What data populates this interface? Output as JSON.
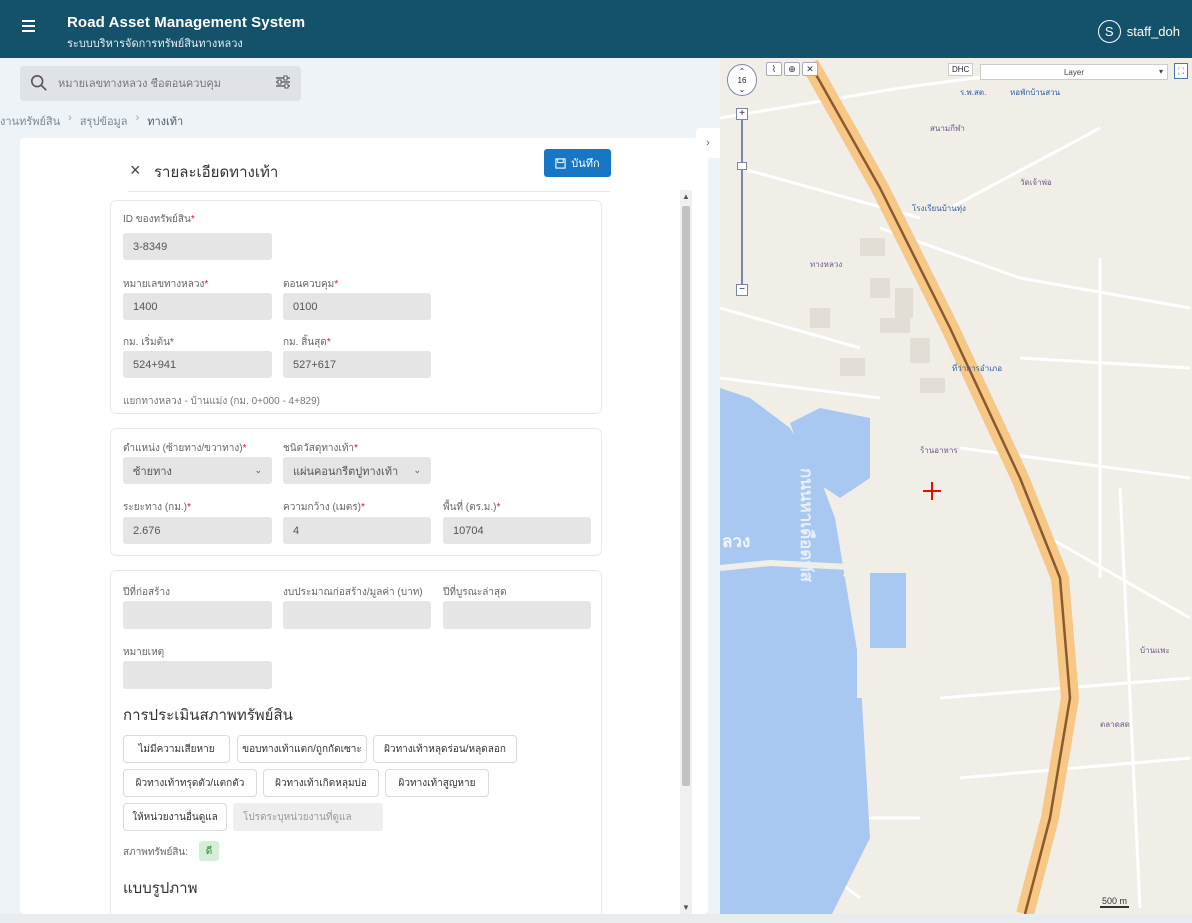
{
  "header": {
    "title": "Road Asset Management System",
    "subtitle": "ระบบบริหารจัดการทรัพย์สินทางหลวง",
    "user_initial": "S",
    "username": "staff_doh"
  },
  "search": {
    "placeholder": "หมายเลขทางหลวง ชื่อตอนควบคุม"
  },
  "breadcrumb": [
    "งานทรัพย์สิน",
    "สรุปข้อมูล",
    "ทางเท้า"
  ],
  "panel": {
    "title": "รายละเอียดทางเท้า",
    "save_label": "บันทึก"
  },
  "fields": {
    "asset_id": {
      "label": "ID ของทรัพย์สิน",
      "value": "3-8349"
    },
    "highway_no": {
      "label": "หมายเลขทางหลวง",
      "value": "1400"
    },
    "control_section": {
      "label": "ตอนควบคุม",
      "value": "0100"
    },
    "km_start": {
      "label": "กม. เริ่มต้น",
      "value": "524+941"
    },
    "km_end": {
      "label": "กม. สิ้นสุด",
      "value": "527+617"
    },
    "section_note": "แยกทางหลวง - บ้านแม่ง (กม. 0+000 - 4+829)",
    "position": {
      "label": "ตำแหน่ง (ซ้ายทาง/ขวาทาง)",
      "value": "ซ้ายทาง"
    },
    "material": {
      "label": "ชนิดวัสดุทางเท้า",
      "value": "แผ่นคอนกรีตปูทางเท้า"
    },
    "distance": {
      "label": "ระยะทาง (กม.)",
      "value": "2.676"
    },
    "width": {
      "label": "ความกว้าง (เมตร)",
      "value": "4"
    },
    "area": {
      "label": "พื้นที่ (ตร.ม.)",
      "value": "10704"
    },
    "build_year": {
      "label": "ปีที่ก่อสร้าง",
      "value": ""
    },
    "budget": {
      "label": "งบประมาณก่อสร้าง/มูลค่า (บาท)",
      "value": ""
    },
    "repair_year": {
      "label": "ปีที่บูรณะล่าสุด",
      "value": ""
    },
    "remark": {
      "label": "หมายเหตุ",
      "value": ""
    }
  },
  "assessment": {
    "heading": "การประเมินสภาพทรัพย์สิน",
    "chips": [
      "ไม่มีความเสียหาย",
      "ขอบทางเท้าแตก/ถูกกัดเซาะ",
      "ผิวทางเท้าหลุดร่อน/หลุดลอก",
      "ผิวทางเท้าทรุดตัว/แตกตัว",
      "ผิวทางเท้าเกิดหลุมบ่อ",
      "ผิวทางเท้าสูญหาย"
    ],
    "agency_chip": "ให้หน่วยงานอื่นดูแล",
    "agency_placeholder": "โปรดระบุหน่วยงานที่ดูแล",
    "status_label": "สภาพทรัพย์สิน:",
    "status_value": "ดี"
  },
  "photos_heading": "แบบรูปภาพ",
  "map": {
    "zoom_level": "16",
    "dhc_label": "DHC",
    "layer_label": "Layer",
    "water_label_1": "กนนหาเดือดทัส",
    "water_label_2": "ลวง",
    "scale_label": "500 m",
    "places": [
      "สนามกีฬา",
      "ทางหลวง",
      "ร.พ.สต.",
      "วัดเจ้าพ่อ",
      "ร้านอาหาร",
      "หอพักบ้านสวน",
      "ที่ว่าการอำเภอ",
      "โรงเรียนบ้านทุ่ง",
      "ตลาดสด",
      "บ้านแพะ"
    ]
  }
}
